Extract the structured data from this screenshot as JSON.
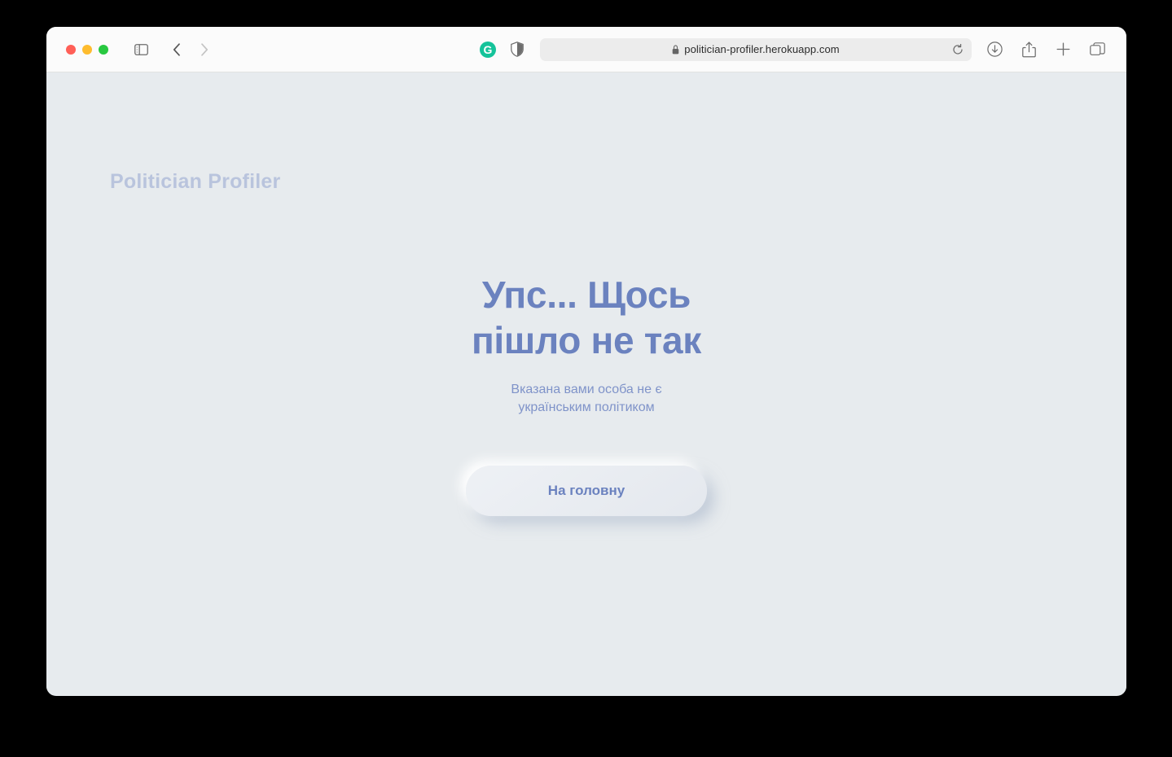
{
  "browser": {
    "window_controls": [
      {
        "name": "close",
        "color": "#ff5f57"
      },
      {
        "name": "minimize",
        "color": "#febc2e"
      },
      {
        "name": "maximize",
        "color": "#28c840"
      }
    ],
    "sidebar_toggle_label": "Sidebar",
    "back_label": "Back",
    "forward_label": "Forward",
    "grammarly_label": "G",
    "shield_label": "Privacy Report",
    "url": "politician-profiler.herokuapp.com",
    "url_placeholder": "Search or enter website name",
    "reload_label": "Reload",
    "downloads_label": "Downloads",
    "share_label": "Share",
    "new_tab_label": "New Tab",
    "tab_overview_label": "Tab Overview"
  },
  "page": {
    "logo": "Politician Profiler",
    "error_title_line1": "Упс... Щось",
    "error_title_line2": "пішло не так",
    "error_subtitle": "Вказана вами особа не є українським політиком",
    "home_button_label": "На головну"
  },
  "colors": {
    "page_background": "#e7ebee",
    "toolbar_background": "#fbfbfb",
    "logo_text": "#b9c4dd",
    "heading_text": "#6b82bf",
    "subtitle_text": "#7f93c9",
    "button_text": "#6b82bf",
    "grammarly_green": "#15c39a"
  }
}
